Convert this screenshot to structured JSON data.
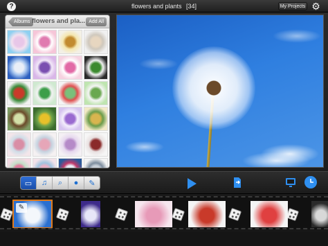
{
  "topbar": {
    "help_icon": "?",
    "title": "flowers and plants",
    "count": "[34]",
    "my_projects_label": "My Projects",
    "settings_icon": "gear-icon"
  },
  "album": {
    "back_label": "Albums",
    "title": "flowers and pla...",
    "add_all_label": "Add All",
    "thumbnails": [
      {
        "name": "thumb-1",
        "colors": [
          "#8fd0f0",
          "#e8c7e8",
          "#f3e1ef"
        ]
      },
      {
        "name": "thumb-2",
        "colors": [
          "#f6c6d8",
          "#e07ab0",
          "#ffffff"
        ]
      },
      {
        "name": "thumb-3",
        "colors": [
          "#f3f0e6",
          "#c28b2f",
          "#f5e7b0"
        ]
      },
      {
        "name": "thumb-4",
        "colors": [
          "#f0f0f0",
          "#e7d6c0",
          "#cfc8bd"
        ]
      },
      {
        "name": "thumb-5",
        "colors": [
          "#2c5fbf",
          "#e9eef7",
          "#a8c6ef"
        ]
      },
      {
        "name": "thumb-6",
        "colors": [
          "#d9b6e8",
          "#7a4fb0",
          "#f2e8f8"
        ]
      },
      {
        "name": "thumb-7",
        "colors": [
          "#f6d2e0",
          "#e26aa6",
          "#ffffff"
        ]
      },
      {
        "name": "thumb-8",
        "colors": [
          "#2a2a2a",
          "#3c8a2f",
          "#f1f1f1"
        ]
      },
      {
        "name": "thumb-9",
        "colors": [
          "#f2f2f2",
          "#c93a2a",
          "#3a8b3a"
        ]
      },
      {
        "name": "thumb-10",
        "colors": [
          "#cfe9d0",
          "#3d9e4a",
          "#f2f2f2"
        ]
      },
      {
        "name": "thumb-11",
        "colors": [
          "#f4f4f4",
          "#7ac07a",
          "#e05050"
        ]
      },
      {
        "name": "thumb-12",
        "colors": [
          "#bfe5b0",
          "#6aa84f",
          "#f5f5f5"
        ]
      },
      {
        "name": "thumb-13",
        "colors": [
          "#7e9b64",
          "#d3e0a8",
          "#6b4a2a"
        ]
      },
      {
        "name": "thumb-14",
        "colors": [
          "#3c6b2e",
          "#e7c12a",
          "#6ea24a"
        ]
      },
      {
        "name": "thumb-15",
        "colors": [
          "#d6c4ef",
          "#9a6ad0",
          "#f4eefc"
        ]
      },
      {
        "name": "thumb-16",
        "colors": [
          "#f2e9c6",
          "#d8b54f",
          "#6b9c4a"
        ]
      },
      {
        "name": "thumb-17",
        "colors": [
          "#f3e6ea",
          "#d98ea6",
          "#cfdde8"
        ]
      },
      {
        "name": "thumb-18",
        "colors": [
          "#f5f1f2",
          "#e6a6b8",
          "#c6d3e0"
        ]
      },
      {
        "name": "thumb-19",
        "colors": [
          "#f4f0f4",
          "#b58ac8",
          "#e6d8ee"
        ]
      },
      {
        "name": "thumb-20",
        "colors": [
          "#f6f6f6",
          "#8a2a2a",
          "#e8e0e0"
        ]
      },
      {
        "name": "thumb-21",
        "colors": [
          "#f3d9e2",
          "#e07a9b",
          "#c3e0c8"
        ]
      },
      {
        "name": "thumb-22",
        "colors": [
          "#f2e2e9",
          "#e9b0c6",
          "#a0c4e0"
        ]
      },
      {
        "name": "thumb-23",
        "colors": [
          "#2d5b9b",
          "#e9eef8",
          "#c03a6a"
        ]
      },
      {
        "name": "thumb-24",
        "colors": [
          "#f4f4f4",
          "#c7cfd8",
          "#7d8d9e"
        ]
      }
    ]
  },
  "toolbar": {
    "tools": [
      {
        "name": "photo-tool",
        "icon": "▭",
        "active": true
      },
      {
        "name": "music-tool",
        "icon": "♫",
        "active": false
      },
      {
        "name": "zoom-tool",
        "icon": "⌕",
        "active": false
      },
      {
        "name": "transition-tool",
        "icon": "●",
        "active": false
      },
      {
        "name": "text-tool",
        "icon": "✎",
        "active": false
      }
    ],
    "play_icon": "play-icon",
    "export_icon": "export-icon",
    "monitor_icon": "monitor-icon",
    "timer_icon": "clock-icon"
  },
  "timeline": {
    "slides": [
      {
        "name": "slide-1",
        "colors": [
          "#2a6fd0",
          "#f4f7fb"
        ],
        "selected": true
      },
      {
        "name": "slide-2",
        "colors": [
          "#3d2a8a",
          "#e7e7f8"
        ],
        "selected": false
      },
      {
        "name": "slide-3",
        "colors": [
          "#f6e6ee",
          "#e79ab8"
        ],
        "selected": false
      },
      {
        "name": "slide-4",
        "colors": [
          "#f4f4f4",
          "#c93a2a"
        ],
        "selected": false
      },
      {
        "name": "slide-5",
        "colors": [
          "#f4f4f4",
          "#e04040"
        ],
        "selected": false
      },
      {
        "name": "slide-6",
        "colors": [
          "#2a2a2a",
          "#d8d8d8"
        ],
        "selected": false
      }
    ],
    "edit_icon": "edit-icon"
  }
}
